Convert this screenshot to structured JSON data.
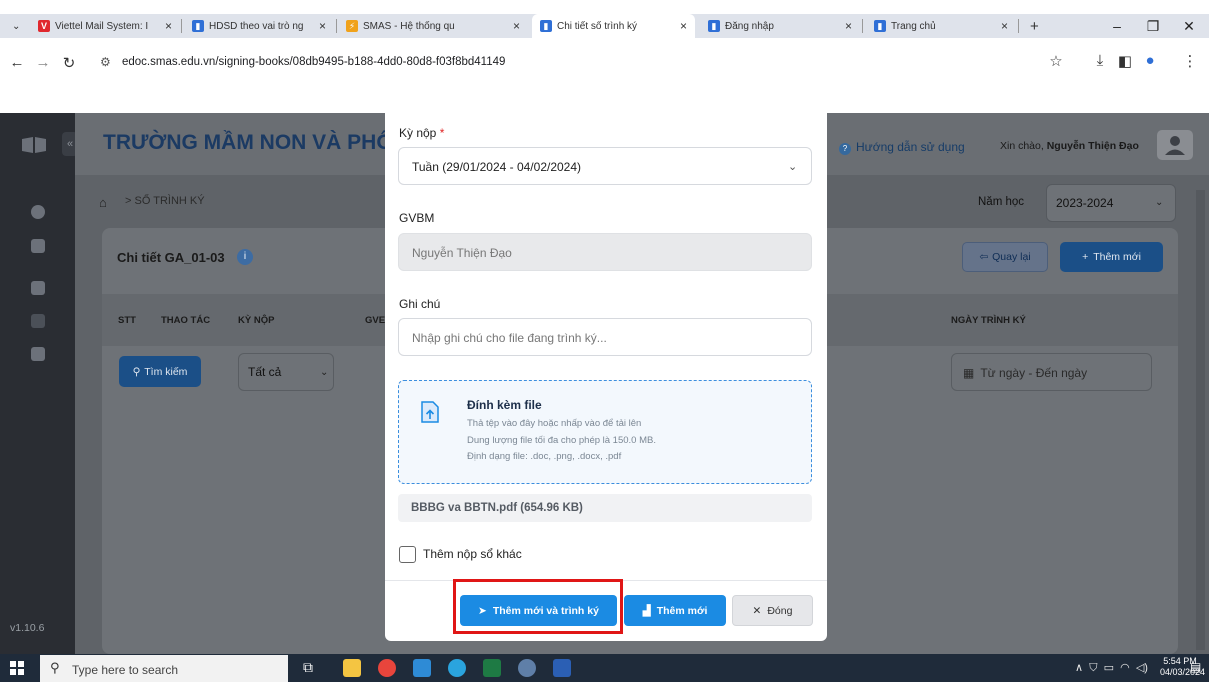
{
  "browser": {
    "tabs": [
      {
        "label": "Viettel Mail System: I",
        "active": false
      },
      {
        "label": "HDSD theo vai trò ng",
        "active": false
      },
      {
        "label": "SMAS - Hệ thống qu",
        "active": false
      },
      {
        "label": "Chi tiết sổ trình ký",
        "active": true
      },
      {
        "label": "Đăng nhập",
        "active": false
      },
      {
        "label": "Trang chủ",
        "active": false
      }
    ],
    "url": "edoc.smas.edu.vn/signing-books/08db9495-b188-4dd0-80d8-f03f8bd41149"
  },
  "app": {
    "school_name": "TRƯỜNG MẦM NON VÀ PHỔ TH",
    "help_link": "Hướng dẫn sử dụng",
    "greeting_prefix": "Xin chào, ",
    "user_name": "Nguyễn Thiện Đạo",
    "breadcrumb": "> SỔ TRÌNH KÝ",
    "school_year_label": "Năm học",
    "school_year_value": "2023-2024",
    "card_title": "Chi tiết GA_01-03",
    "back_label": "Quay lại",
    "add_new_label": "Thêm mới",
    "table_headers": [
      "STT",
      "THAO TÁC",
      "KỲ NỘP",
      "GVE",
      "NGÀY TRÌNH KÝ"
    ],
    "search_label": "Tìm kiếm",
    "filter_value": "Tất cả",
    "date_placeholder": "Từ ngày - Đến ngày",
    "version": "v1.10.6"
  },
  "modal": {
    "period_label": "Kỳ nộp",
    "period_required": "*",
    "period_value": "Tuần (29/01/2024 - 04/02/2024)",
    "teacher_label": "GVBM",
    "teacher_value": "Nguyễn Thiện Đạo",
    "note_label": "Ghi chú",
    "note_placeholder": "Nhập ghi chú cho file đang trình ký...",
    "attach_title": "Đính kèm file",
    "attach_hint_1": "Thả tệp vào đây hoặc nhấp vào để tải lên",
    "attach_hint_2": "Dung lượng file tối đa cho phép là 150.0 MB.",
    "attach_hint_3": "Định dạng file: .doc, .png, .docx, .pdf",
    "attached_file": "BBBG va BBTN.pdf (654.96 KB)",
    "other_book_label": "Thêm nộp sổ khác",
    "submit_sign_label": "Thêm mới và trình ký",
    "add_label": "Thêm mới",
    "close_label": "Đóng"
  },
  "taskbar": {
    "search_placeholder": "Type here to search",
    "time": "5:54 PM",
    "date": "04/03/2024"
  },
  "colors": {
    "accent": "#1b8be3",
    "header_text": "#1b3a63",
    "highlight": "#e01616"
  }
}
